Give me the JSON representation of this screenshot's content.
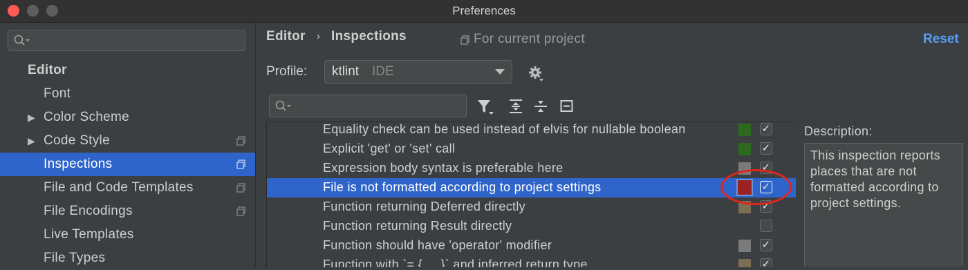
{
  "window": {
    "title": "Preferences"
  },
  "sidebar": {
    "search_placeholder": "",
    "header": "Editor",
    "items": [
      {
        "label": "Font",
        "arrow": "",
        "copy_icon": false,
        "selected": false
      },
      {
        "label": "Color Scheme",
        "arrow": "▶",
        "copy_icon": false,
        "selected": false
      },
      {
        "label": "Code Style",
        "arrow": "▶",
        "copy_icon": true,
        "selected": false
      },
      {
        "label": "Inspections",
        "arrow": "",
        "copy_icon": true,
        "selected": true
      },
      {
        "label": "File and Code Templates",
        "arrow": "",
        "copy_icon": true,
        "selected": false
      },
      {
        "label": "File Encodings",
        "arrow": "",
        "copy_icon": true,
        "selected": false
      },
      {
        "label": "Live Templates",
        "arrow": "",
        "copy_icon": false,
        "selected": false
      },
      {
        "label": "File Types",
        "arrow": "",
        "copy_icon": false,
        "selected": false
      }
    ]
  },
  "header": {
    "breadcrumb_root": "Editor",
    "breadcrumb_separator": "›",
    "breadcrumb_current": "Inspections",
    "scope_text": "For current project",
    "reset_label": "Reset"
  },
  "profile": {
    "label": "Profile:",
    "value": "ktlint",
    "scope": "IDE"
  },
  "toolbar": {
    "search_placeholder": "",
    "icons": [
      "filter-icon",
      "expand-all-icon",
      "collapse-all-icon",
      "reset-to-empty-icon"
    ]
  },
  "inspections": [
    {
      "text": "Equality check can be used instead of elvis for nullable boolean",
      "severity_color": "#2d6a1e",
      "checked": true,
      "selected": false
    },
    {
      "text": "Explicit 'get' or 'set' call",
      "severity_color": "#2d6a1e",
      "checked": true,
      "selected": false
    },
    {
      "text": "Expression body syntax is preferable here",
      "severity_color": "#7a7a7a",
      "checked": true,
      "selected": false
    },
    {
      "text": "File is not formatted according to project settings",
      "severity_color": "#9b2222",
      "checked": true,
      "selected": true
    },
    {
      "text": "Function returning Deferred directly",
      "severity_color": "#7a6e55",
      "checked": true,
      "selected": false
    },
    {
      "text": "Function returning Result directly",
      "severity_color": "",
      "checked": false,
      "selected": false
    },
    {
      "text": "Function should have 'operator' modifier",
      "severity_color": "#7a7a7a",
      "checked": true,
      "selected": false
    },
    {
      "text": "Function with `= { ... }` and inferred return type",
      "severity_color": "#7a6e55",
      "checked": true,
      "selected": false
    }
  ],
  "description": {
    "label": "Description:",
    "text": "This inspection reports places that are not formatted according to project settings."
  },
  "colors": {
    "accent": "#2f65ca",
    "link": "#589df6",
    "annotation": "#e0251e"
  }
}
